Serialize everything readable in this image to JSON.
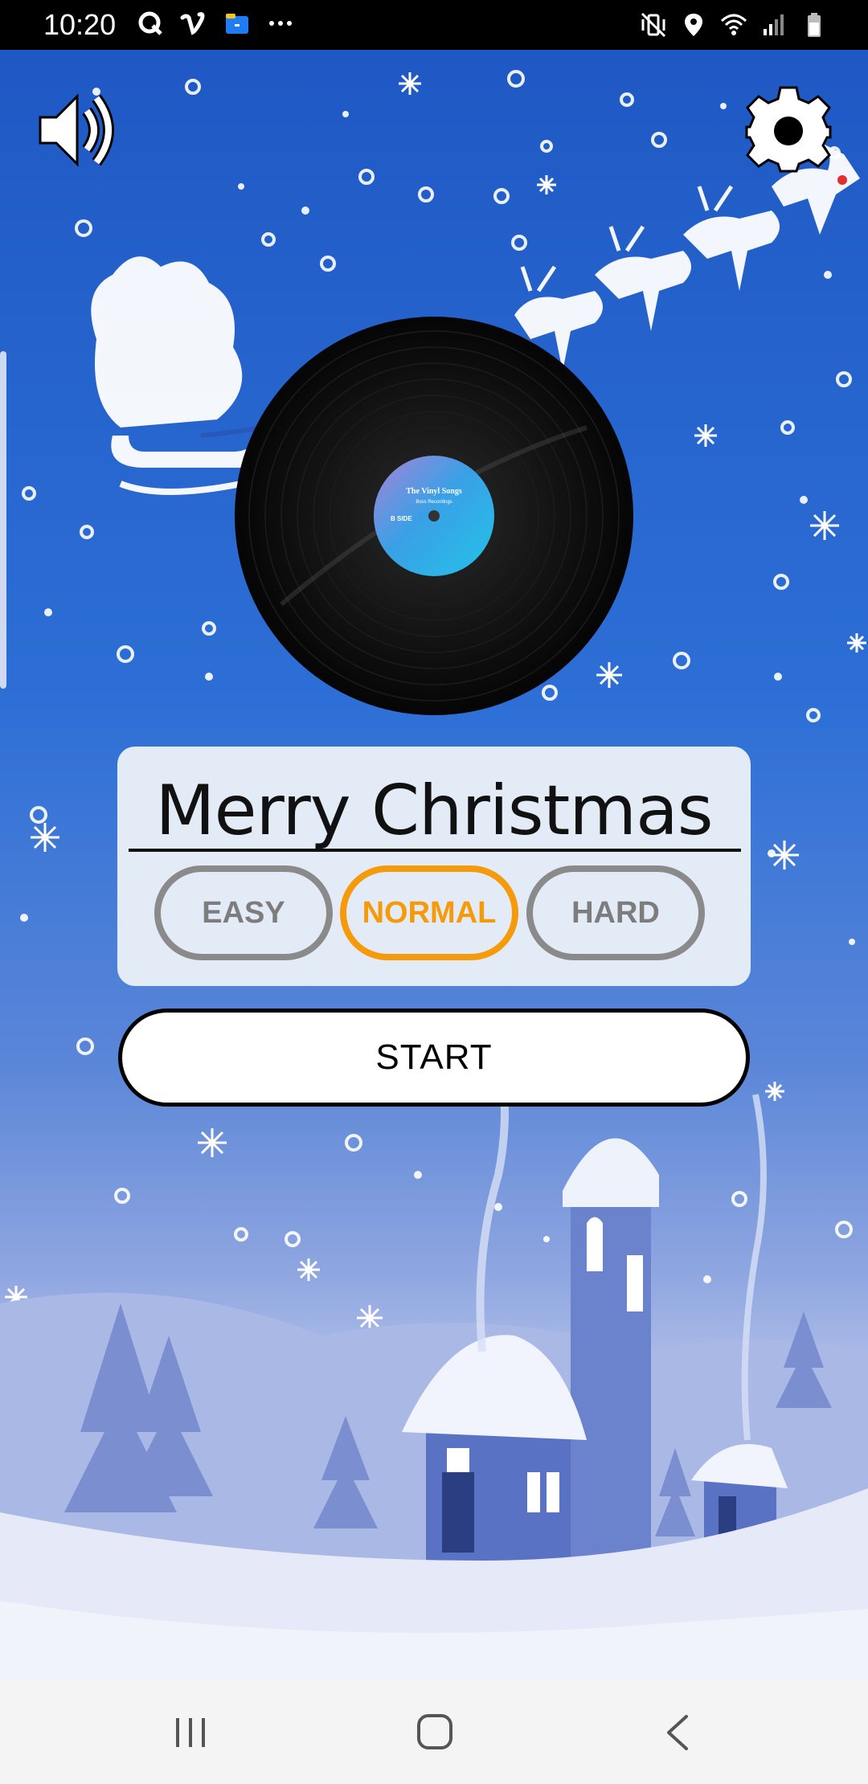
{
  "status_bar": {
    "time": "10:20",
    "left_icons": [
      "q-app-icon",
      "vimeo-icon",
      "files-icon",
      "more-dots-icon"
    ],
    "right_icons": [
      "vibrate-mute-icon",
      "location-icon",
      "wifi-icon",
      "signal-icon",
      "battery-icon"
    ]
  },
  "top_controls": {
    "sound_icon": "speaker-icon",
    "settings_icon": "gear-icon"
  },
  "record": {
    "label_title": "The Vinyl Songs",
    "label_subtitle": "Boss Recordings",
    "label_side": "B SIDE"
  },
  "song": {
    "title": "Merry Christmas"
  },
  "difficulty": {
    "options": [
      "EASY",
      "NORMAL",
      "HARD"
    ],
    "selected": "NORMAL"
  },
  "start_label": "START",
  "colors": {
    "selected_accent": "#f59a0b",
    "unselected": "#8a8a8a",
    "card_bg": "#e3ebf6"
  },
  "nav_bar": {
    "icons": [
      "recents-icon",
      "home-icon",
      "back-icon"
    ]
  }
}
